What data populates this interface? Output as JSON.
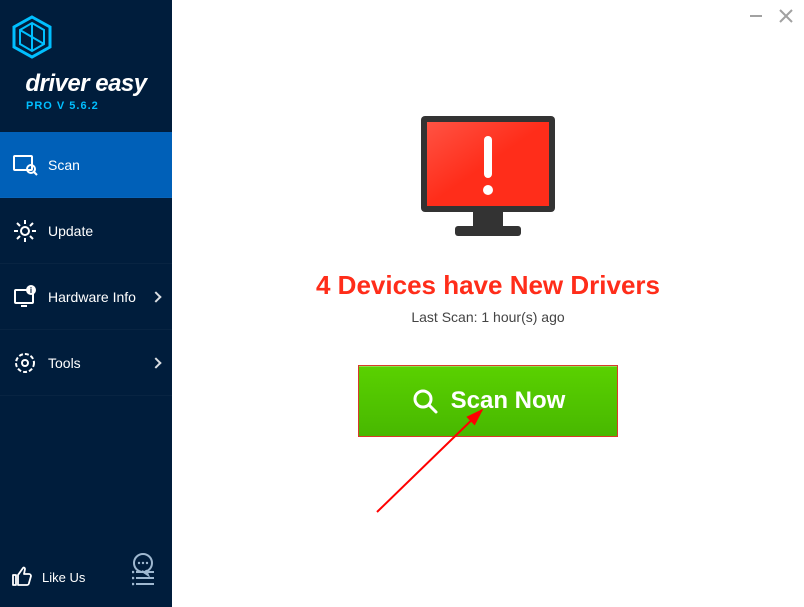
{
  "brand": "driver easy",
  "version": "PRO V 5.6.2",
  "nav": {
    "scan": "Scan",
    "update": "Update",
    "hardware": "Hardware Info",
    "tools": "Tools"
  },
  "like": "Like Us",
  "main": {
    "headline": "4 Devices have New Drivers",
    "lastscan": "Last Scan: 1 hour(s) ago",
    "scanbtn": "Scan Now"
  }
}
